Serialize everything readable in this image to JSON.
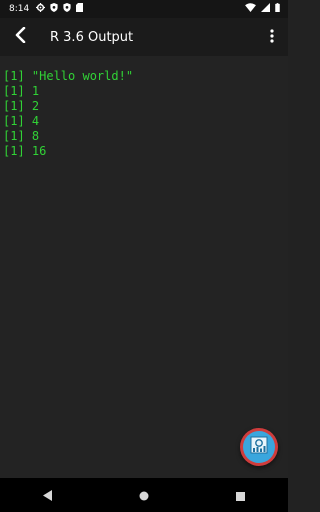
{
  "status_bar": {
    "time": "8:14",
    "left_icons": [
      "settings-icon",
      "shield-icon",
      "shield-icon",
      "sd-card-icon"
    ],
    "right_icons": [
      "wifi-icon",
      "signal-icon",
      "battery-icon"
    ]
  },
  "toolbar": {
    "title": "R 3.6 Output",
    "back_icon": "chevron-left-icon",
    "menu_icon": "more-vert-icon"
  },
  "console": {
    "lines": [
      "[1] \"Hello world!\"",
      "[1] 1",
      "[1] 2",
      "[1] 4",
      "[1] 8",
      "[1] 16"
    ],
    "text_color": "#31d236",
    "background": "#232323"
  },
  "fab": {
    "icon": "chart-icon",
    "ring_color": "#cf3c3c",
    "fill_color": "#3aa6dd"
  },
  "nav_bar": {
    "buttons": [
      "back-triangle-icon",
      "home-circle-icon",
      "recents-square-icon"
    ]
  }
}
